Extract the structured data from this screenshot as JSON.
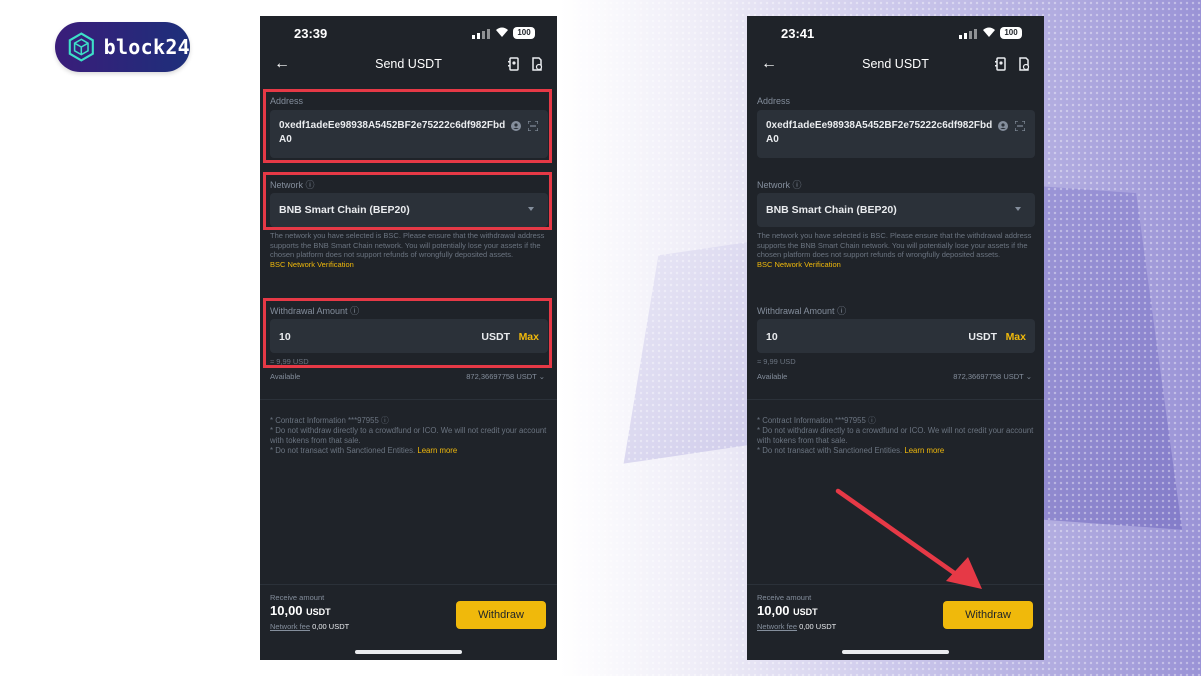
{
  "brand": {
    "name": "block24"
  },
  "colors": {
    "accent": "#f0b90b",
    "highlight": "#e63946",
    "panel": "#1f2329",
    "field": "#2b3139"
  },
  "screens": [
    {
      "status": {
        "time": "23:39",
        "battery": "100"
      },
      "header": {
        "title": "Send USDT",
        "back_icon": "arrow-left-icon"
      },
      "address": {
        "label": "Address",
        "value": "0xedf1adeEe98938A5452BF2e75222c6df982FbdA0"
      },
      "network": {
        "label": "Network",
        "selected": "BNB Smart Chain (BEP20)",
        "warning": "The network you have selected is BSC. Please ensure that the withdrawal address supports the BNB Smart Chain network. You will potentially lose your assets if the chosen platform does not support refunds of wrongfully deposited assets.",
        "verify_link": "BSC Network Verification"
      },
      "amount": {
        "label": "Withdrawal Amount",
        "value": "10",
        "unit": "USDT",
        "max_label": "Max",
        "approx": "≈ 9,99 USD",
        "available_label": "Available",
        "available_value": "872,36697758 USDT"
      },
      "info": {
        "contract": "* Contract Information ***97955",
        "line1": "* Do not withdraw directly to a crowdfund or ICO. We will not credit your account with tokens from that sale.",
        "line2": "* Do not transact with Sanctioned Entities.",
        "learn_more": "Learn more"
      },
      "footer": {
        "receive_label": "Receive amount",
        "receive_value": "10,00",
        "receive_unit": "USDT",
        "fee_label": "Network fee",
        "fee_value": "0,00 USDT",
        "withdraw_label": "Withdraw"
      }
    },
    {
      "status": {
        "time": "23:41",
        "battery": "100"
      },
      "header": {
        "title": "Send USDT",
        "back_icon": "arrow-left-icon"
      },
      "address": {
        "label": "Address",
        "value": "0xedf1adeEe98938A5452BF2e75222c6df982FbdA0"
      },
      "network": {
        "label": "Network",
        "selected": "BNB Smart Chain (BEP20)",
        "warning": "The network you have selected is BSC. Please ensure that the withdrawal address supports the BNB Smart Chain network. You will potentially lose your assets if the chosen platform does not support refunds of wrongfully deposited assets.",
        "verify_link": "BSC Network Verification"
      },
      "amount": {
        "label": "Withdrawal Amount",
        "value": "10",
        "unit": "USDT",
        "max_label": "Max",
        "approx": "≈ 9,99 USD",
        "available_label": "Available",
        "available_value": "872,36697758 USDT"
      },
      "info": {
        "contract": "* Contract Information ***97955",
        "line1": "* Do not withdraw directly to a crowdfund or ICO. We will not credit your account with tokens from that sale.",
        "line2": "* Do not transact with Sanctioned Entities.",
        "learn_more": "Learn more"
      },
      "footer": {
        "receive_label": "Receive amount",
        "receive_value": "10,00",
        "receive_unit": "USDT",
        "fee_label": "Network fee",
        "fee_value": "0,00 USDT",
        "withdraw_label": "Withdraw"
      }
    }
  ]
}
